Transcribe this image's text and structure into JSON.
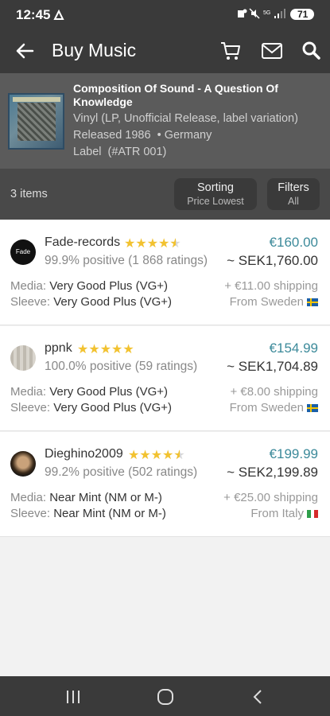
{
  "status": {
    "time": "12:45",
    "battery": "71"
  },
  "appbar": {
    "title": "Buy Music",
    "back_icon": "arrow-left-icon",
    "cart_icon": "cart-icon",
    "mail_icon": "mail-icon",
    "search_icon": "search-icon"
  },
  "release": {
    "title": "Composition Of Sound - A Question Of Knowledge",
    "format": "Vinyl (LP, Unofficial Release, label variation)",
    "released": "Released 1986",
    "country": "• Germany",
    "label": "Label",
    "catno": "(#ATR 001)"
  },
  "toolbar": {
    "count": "3 items",
    "sorting_label": "Sorting",
    "sorting_value": "Price Lowest",
    "filters_label": "Filters",
    "filters_value": "All"
  },
  "listings": [
    {
      "seller": "Fade-records",
      "avatar_text": "Fade",
      "stars": 4.5,
      "ratings": "99.9% positive (1 868 ratings)",
      "price": "€160.00",
      "sek": "~ SEK1,760.00",
      "media_label": "Media:",
      "media": "Very Good Plus (VG+)",
      "sleeve_label": "Sleeve:",
      "sleeve": "Very Good Plus (VG+)",
      "shipping": "+ €11.00 shipping",
      "from": "From Sweden",
      "flag": "sweden"
    },
    {
      "seller": "ppnk",
      "avatar_text": "",
      "stars": 5,
      "ratings": "100.0% positive (59 ratings)",
      "price": "€154.99",
      "sek": "~ SEK1,704.89",
      "media_label": "Media:",
      "media": "Very Good Plus (VG+)",
      "sleeve_label": "Sleeve:",
      "sleeve": "Very Good Plus (VG+)",
      "shipping": "+ €8.00 shipping",
      "from": "From Sweden",
      "flag": "sweden"
    },
    {
      "seller": "Dieghino2009",
      "avatar_text": "",
      "stars": 4.5,
      "ratings": "99.2% positive (502 ratings)",
      "price": "€199.99",
      "sek": "~ SEK2,199.89",
      "media_label": "Media:",
      "media": "Near Mint (NM or M-)",
      "sleeve_label": "Sleeve:",
      "sleeve": "Near Mint (NM or M-)",
      "shipping": "+ €25.00 shipping",
      "from": "From Italy",
      "flag": "italy"
    }
  ],
  "colors": {
    "price": "#3c8a9a",
    "star": "#f2c230",
    "bar": "#3a3a3a"
  }
}
